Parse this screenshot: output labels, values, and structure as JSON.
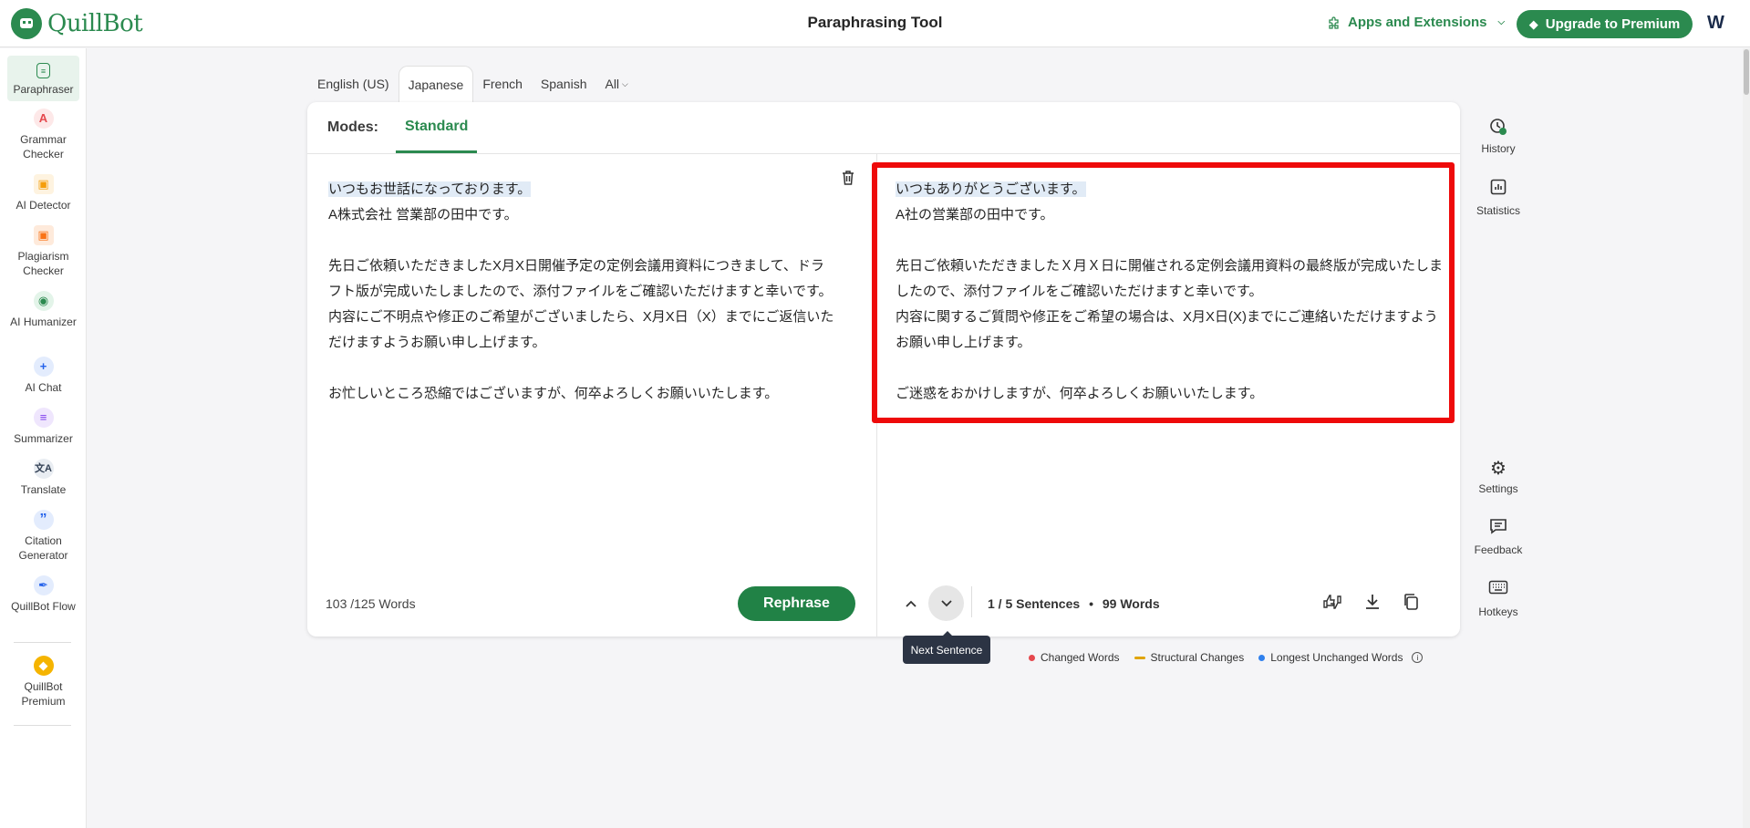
{
  "app": {
    "name": "QuillBot",
    "page_title": "Paraphrasing Tool"
  },
  "header": {
    "apps_label": "Apps and Extensions",
    "upgrade_label": "Upgrade to Premium",
    "avatar_initial": "W"
  },
  "sidebar": {
    "items": [
      {
        "label": "Paraphraser",
        "icon": "paraphraser-icon",
        "color": "#2b8a4f"
      },
      {
        "label": "Grammar Checker",
        "icon": "grammar-icon",
        "color": "#e5484d"
      },
      {
        "label": "AI Detector",
        "icon": "ai-detector-icon",
        "color": "#f59e0b"
      },
      {
        "label": "Plagiarism Checker",
        "icon": "plagiarism-icon",
        "color": "#f97316"
      },
      {
        "label": "AI Humanizer",
        "icon": "humanizer-icon",
        "color": "#2b8a4f"
      },
      {
        "label": "AI Chat",
        "icon": "ai-chat-icon",
        "color": "#2563eb"
      },
      {
        "label": "Summarizer",
        "icon": "summarizer-icon",
        "color": "#7c3aed"
      },
      {
        "label": "Translate",
        "icon": "translate-icon",
        "color": "#334155"
      },
      {
        "label": "Citation Generator",
        "icon": "citation-icon",
        "color": "#2563eb"
      },
      {
        "label": "QuillBot Flow",
        "icon": "flow-icon",
        "color": "#2563eb"
      },
      {
        "label": "QuillBot Premium",
        "icon": "premium-icon",
        "color": "#f5b400"
      }
    ]
  },
  "languages": {
    "tabs": [
      "English (US)",
      "Japanese",
      "French",
      "Spanish",
      "All"
    ],
    "active": "Japanese"
  },
  "modes": {
    "label": "Modes:",
    "active": "Standard"
  },
  "input": {
    "first_sentence": "いつもお世話になっております。",
    "rest": "\nA株式会社 営業部の田中です。\n\n先日ご依頼いただきましたX月X日開催予定の定例会議用資料につきまして、ドラフト版が完成いたしましたので、添付ファイルをご確認いただけますと幸いです。\n内容にご不明点や修正のご希望がございましたら、X月X日（X）までにご返信いただけますようお願い申し上げます。\n\nお忙しいところ恐縮ではございますが、何卒よろしくお願いいたします。",
    "word_count": "103 /125 Words"
  },
  "output": {
    "first_sentence": "いつもありがとうございます。",
    "rest": "\nA社の営業部の田中です。\n\n先日ご依頼いただきましたＸ月Ｘ日に開催される定例会議用資料の最終版が完成いたしましたので、添付ファイルをご確認いただけますと幸いです。\n内容に関するご質問や修正をご希望の場合は、X月X日(X)までにご連絡いただけますようお願い申し上げます。\n\nご迷惑をおかけしますが、何卒よろしくお願いいたします。",
    "sentence_info": "1 / 5 Sentences",
    "word_count": "99 Words"
  },
  "actions": {
    "rephrase_label": "Rephrase",
    "tooltip": "Next Sentence"
  },
  "legend": {
    "items": [
      {
        "label": "Changed Words",
        "color": "#e5484d"
      },
      {
        "label": "Structural Changes",
        "color": "#e0a400"
      },
      {
        "label": "Longest Unchanged Words",
        "color": "#2f80ed"
      }
    ]
  },
  "right_tools": {
    "items": [
      {
        "label": "History",
        "icon": "history-icon"
      },
      {
        "label": "Statistics",
        "icon": "statistics-icon"
      },
      {
        "label": "Settings",
        "icon": "settings-icon"
      },
      {
        "label": "Feedback",
        "icon": "feedback-icon"
      },
      {
        "label": "Hotkeys",
        "icon": "hotkeys-icon"
      }
    ]
  }
}
